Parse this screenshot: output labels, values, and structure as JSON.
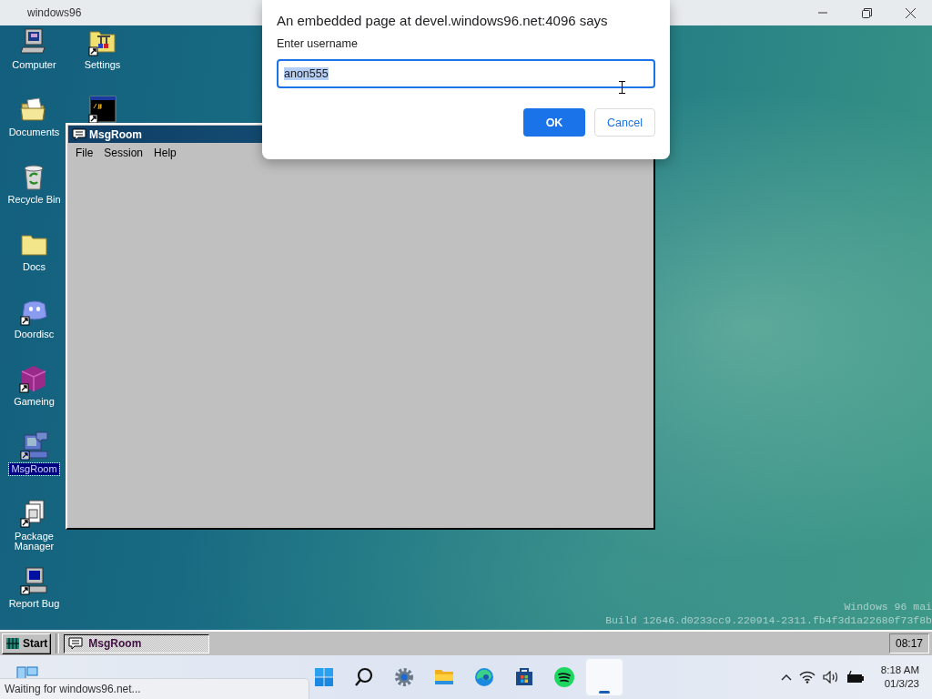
{
  "browser_bar": {
    "title": "windows96"
  },
  "desktop_icons": [
    {
      "kind": "computer",
      "label": "Computer",
      "shortcut": false,
      "selected": false
    },
    {
      "kind": "documents",
      "label": "Documents",
      "shortcut": false,
      "selected": false
    },
    {
      "kind": "recycle",
      "label": "Recycle Bin",
      "shortcut": false,
      "selected": false
    },
    {
      "kind": "folder",
      "label": "Docs",
      "shortcut": false,
      "selected": false
    },
    {
      "kind": "chat",
      "label": "Doordisc",
      "shortcut": true,
      "selected": false
    },
    {
      "kind": "cube",
      "label": "Gameing",
      "shortcut": true,
      "selected": false
    },
    {
      "kind": "msgroom",
      "label": "MsgRoom",
      "shortcut": true,
      "selected": true
    },
    {
      "kind": "package",
      "label": "Package Manager",
      "shortcut": true,
      "selected": false
    },
    {
      "kind": "bug",
      "label": "Report Bug",
      "shortcut": true,
      "selected": false
    },
    {
      "kind": "settings",
      "label": "Settings",
      "shortcut": true,
      "selected": false
    },
    {
      "kind": "terminal",
      "shortcut": true,
      "selected": false
    }
  ],
  "msgroom_window": {
    "title": "MsgRoom",
    "menu": [
      "File",
      "Session",
      "Help"
    ]
  },
  "build_info": [
    "Windows 96 mai",
    "Build 12646.d0233cc9.220914-2311.fb4f3d1a22680f73f8b"
  ],
  "dialog": {
    "heading": "An embedded page at devel.windows96.net:4096 says",
    "prompt": "Enter username",
    "value": "anon555",
    "value_selected": true,
    "buttons": [
      {
        "label": "OK",
        "kind": "primary"
      },
      {
        "label": "Cancel",
        "kind": "secondary"
      }
    ]
  },
  "w96_taskbar": {
    "start": "Start",
    "tasks": [
      {
        "label": "MsgRoom",
        "selected": true
      }
    ],
    "clock": "08:17"
  },
  "w11_taskbar": {
    "apps": [
      {
        "kind": "start",
        "active": false
      },
      {
        "kind": "search",
        "active": false
      },
      {
        "kind": "settings",
        "active": false
      },
      {
        "kind": "explorer",
        "active": false
      },
      {
        "kind": "edge",
        "active": false
      },
      {
        "kind": "store",
        "active": false
      },
      {
        "kind": "music",
        "active": false
      },
      {
        "kind": "blank",
        "active": true
      }
    ],
    "tray_time": "8:18 AM",
    "tray_date": "01/3/23"
  },
  "status_tip": "Waiting for windows96.net..."
}
